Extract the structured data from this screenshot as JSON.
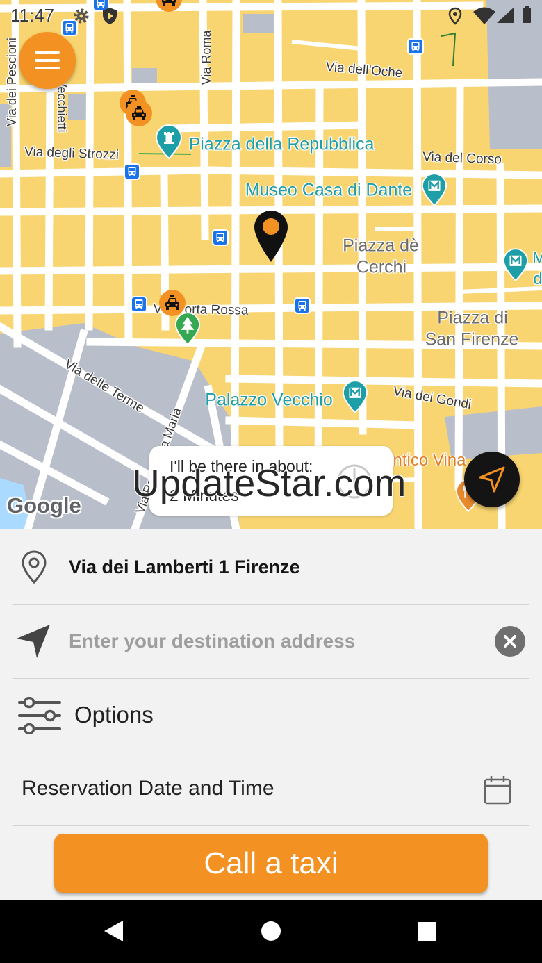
{
  "status_bar": {
    "time": "11:47",
    "icons_left": [
      "gear-icon",
      "bus-icon",
      "shield-icon"
    ],
    "icons_right": [
      "location-icon",
      "wifi-icon",
      "signal-icon",
      "battery-icon"
    ]
  },
  "map": {
    "menu_button_icon": "hamburger-menu-icon",
    "locate_button_icon": "navigation-arrow-icon",
    "labels": {
      "via_dei_pescioni": "Via dei Pescioni",
      "vecchietti": "Vecchietti",
      "via_roma": "Via Roma",
      "via_dell_oche": "Via dell'Oche",
      "via_degli_strozzi": "Via degli Strozzi",
      "piazza_della_repubblica": "Piazza della Repubblica",
      "via_del_corso": "Via del Corso",
      "museo_casa_di_dante": "Museo Casa di Dante",
      "piazza_de_cerchi_line1": "Piazza dè",
      "piazza_de_cerchi_line2": "Cerchi",
      "via_porta_rossa": "Via Porta Rossa",
      "piazza_di_san_firenze_line1": "Piazza di",
      "piazza_di_san_firenze_line2": "San Firenze",
      "via_delle_terme": "Via delle Terme",
      "via_por_santa_maria": "Via Por Santa Maria",
      "palazzo_vecchio": "Palazzo Vecchio",
      "via_dei_gondi": "Via dei Gondi",
      "food_place": "ntico Vina",
      "edge_label_1": "M",
      "edge_label_2": "d"
    },
    "eta": {
      "title": "I'll be there in about:",
      "value": "2 Minutes",
      "icon": "clock-icon"
    },
    "google_logo": "Google"
  },
  "watermark": "UpdateStar.com",
  "form": {
    "pickup": {
      "icon": "location-pin-icon",
      "value": "Via dei Lamberti 1 Firenze"
    },
    "destination": {
      "icon": "navigation-arrow-icon",
      "placeholder": "Enter your destination address",
      "clear_icon": "clear-icon"
    },
    "options": {
      "icon": "sliders-icon",
      "label": "Options"
    },
    "reservation": {
      "label": "Reservation Date and Time",
      "icon": "calendar-icon"
    },
    "call_button": {
      "label": "Call a taxi"
    }
  },
  "nav_bar": {
    "icons": [
      "back-icon",
      "home-icon",
      "recents-icon"
    ]
  },
  "colors": {
    "accent": "#f39223",
    "map_land": "#f9d571",
    "poi_teal": "#1e9ea6",
    "bus_blue": "#1a73e8",
    "panel_bg": "#f2f2f2"
  }
}
